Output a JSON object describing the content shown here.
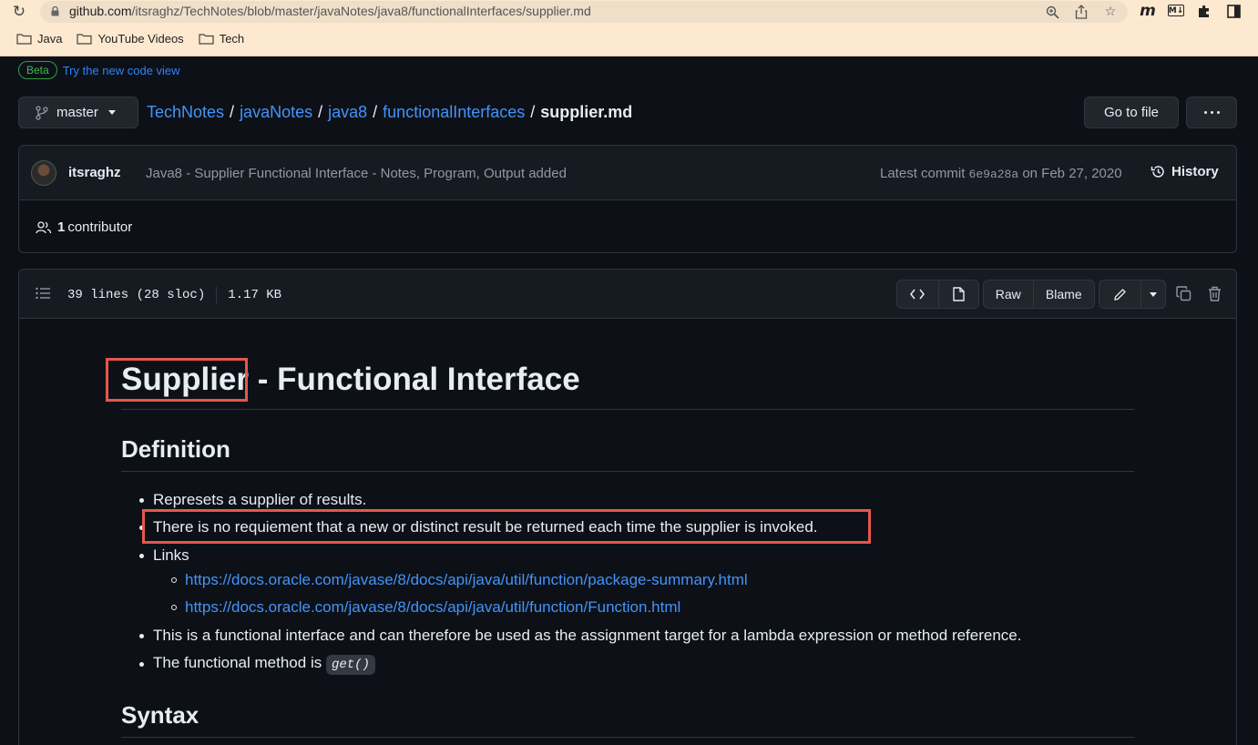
{
  "browser": {
    "url_host": "github.com",
    "url_path": "/itsraghz/TechNotes/blob/master/javaNotes/java8/functionalInterfaces/supplier.md",
    "bookmarks": [
      "Java",
      "YouTube Videos",
      "Tech"
    ],
    "ext_icons": [
      "m",
      "M↓"
    ]
  },
  "beta": {
    "badge": "Beta",
    "link": "Try the new code view"
  },
  "repo": {
    "branch": "master",
    "crumbs": [
      "TechNotes",
      "javaNotes",
      "java8",
      "functionalInterfaces"
    ],
    "file": "supplier.md",
    "separator": "/",
    "goto_label": "Go to file"
  },
  "commit": {
    "author": "itsraghz",
    "message": "Java8 - Supplier Functional Interface - Notes, Program, Output added",
    "latest_prefix": "Latest commit",
    "sha": "6e9a28a",
    "date": "on Feb 27, 2020",
    "history_label": "History",
    "contrib_count": "1",
    "contrib_label": "contributor"
  },
  "file_header": {
    "lines": "39 lines (28 sloc)",
    "size": "1.17 KB",
    "raw_label": "Raw",
    "blame_label": "Blame"
  },
  "markdown": {
    "title_word": "Supplier",
    "title_rest": "- Functional Interface",
    "definition_heading": "Definition",
    "items": [
      "Represets a supplier of results.",
      "There is no requiement that a new or distinct result be returned each time the supplier is invoked.",
      "Links"
    ],
    "links": [
      "https://docs.oracle.com/javase/8/docs/api/java/util/function/package-summary.html",
      "https://docs.oracle.com/javase/8/docs/api/java/util/function/Function.html"
    ],
    "item_functional": "This is a functional interface and can therefore be used as the assignment target for a lambda expression or method reference.",
    "item_method_prefix": "The functional method is",
    "item_method_code": "get()",
    "syntax_heading": "Syntax"
  },
  "colors": {
    "highlight": "#e5574a",
    "link": "#4493f8",
    "page_bg": "#0d1117",
    "chrome_bg": "#fde9d0"
  }
}
